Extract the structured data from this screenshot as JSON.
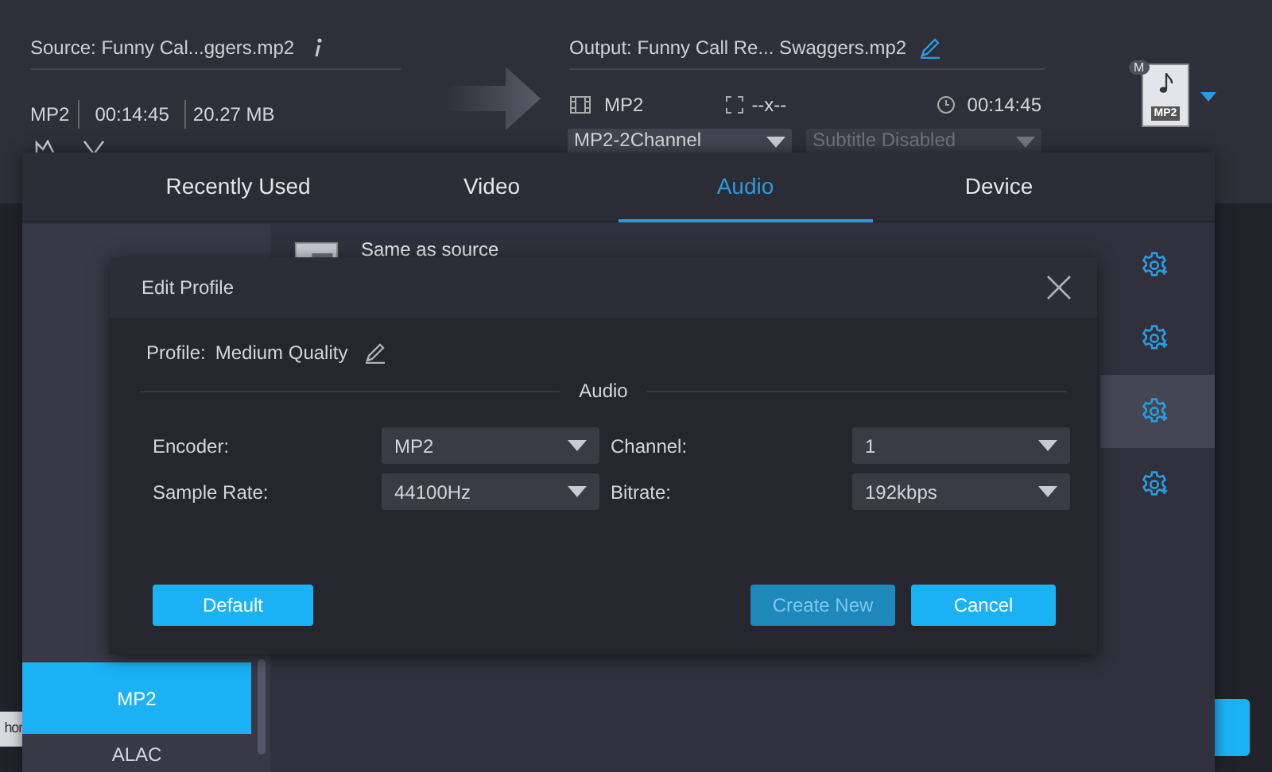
{
  "source": {
    "title": "Source: Funny Cal...ggers.mp2",
    "format": "MP2",
    "duration": "00:14:45",
    "size": "20.27 MB"
  },
  "output": {
    "title": "Output: Funny Call Re... Swaggers.mp2",
    "format": "MP2",
    "resolution": "--x--",
    "duration": "00:14:45",
    "audio_dropdown": {
      "value": "MP2-2Channel",
      "disabled": false
    },
    "subtitle_dropdown": {
      "value": "Subtitle Disabled",
      "disabled": true
    },
    "format_badge": "M",
    "format_icon_label": "MP2"
  },
  "bottom_field": {
    "value": "hor"
  },
  "format_panel": {
    "tabs": [
      {
        "label": "Recently Used",
        "selected": false
      },
      {
        "label": "Video",
        "selected": false
      },
      {
        "label": "Audio",
        "selected": true
      },
      {
        "label": "Device",
        "selected": false
      }
    ],
    "formats": [
      {
        "label": "MP2",
        "selected": true
      },
      {
        "label": "ALAC",
        "selected": false
      }
    ],
    "profiles": [
      {
        "label": "Same as source",
        "selected": false
      },
      {
        "selected": false
      },
      {
        "selected": true
      },
      {
        "selected": false
      }
    ]
  },
  "dialog": {
    "title": "Edit Profile",
    "profile_label": "Profile:",
    "profile_name": "Medium Quality",
    "section": "Audio",
    "fields": [
      {
        "label": "Encoder:",
        "value": "MP2"
      },
      {
        "label": "Channel:",
        "value": "1"
      },
      {
        "label": "Sample Rate:",
        "value": "44100Hz"
      },
      {
        "label": "Bitrate:",
        "value": "192kbps"
      }
    ],
    "buttons": [
      {
        "label": "Default",
        "disabled": false
      },
      {
        "label": "Create New",
        "disabled": true
      },
      {
        "label": "Cancel",
        "disabled": false
      }
    ]
  }
}
